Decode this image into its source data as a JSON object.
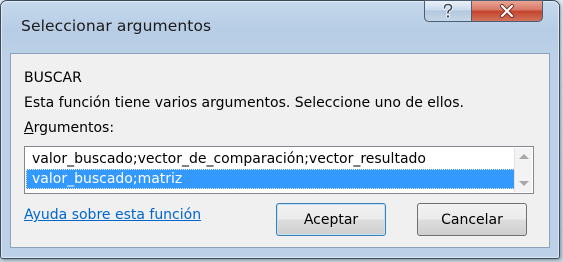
{
  "window": {
    "title": "Seleccionar argumentos",
    "help_icon": "help-icon",
    "close_icon": "close-icon"
  },
  "dialog": {
    "function_name": "BUSCAR",
    "description": "Esta función tiene varios argumentos. Seleccione uno de ellos.",
    "arguments_label_mnemonic": "A",
    "arguments_label_rest": "rgumentos:",
    "arguments": [
      "valor_buscado;vector_de_comparación;vector_resultado",
      "valor_buscado;matriz"
    ],
    "selected_index": 1,
    "help_link": "Ayuda sobre esta función",
    "ok_label": "Aceptar",
    "cancel_label": "Cancelar"
  },
  "colors": {
    "selection": "#3399ff",
    "link": "#0066cc",
    "close_button": "#c4432b"
  }
}
